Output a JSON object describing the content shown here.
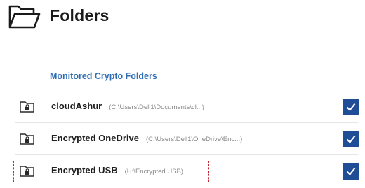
{
  "header": {
    "title": "Folders",
    "icon": "folder-open-icon"
  },
  "section": {
    "title": "Monitored Crypto Folders"
  },
  "folders": [
    {
      "name": "cloudAshur",
      "path": "(C:\\Users\\Dell1\\Documents\\cl...)",
      "checked": true,
      "icon": "locked-folder-icon"
    },
    {
      "name": "Encrypted OneDrive",
      "path": "(C:\\Users\\Dell1\\OneDrive\\Enc...)",
      "checked": true,
      "icon": "locked-folder-icon"
    },
    {
      "name": "Encrypted USB",
      "path": "(H:\\Encrypted USB)",
      "checked": true,
      "icon": "locked-folder-icon"
    }
  ],
  "colors": {
    "accent": "#2f6db5",
    "checkbox": "#1f4e96",
    "highlight": "#c0262f"
  }
}
